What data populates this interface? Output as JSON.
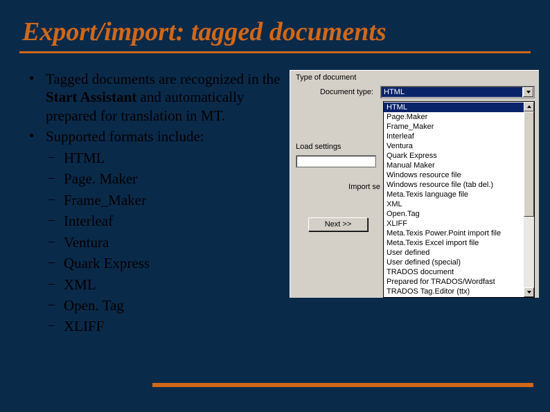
{
  "title": "Export/import: tagged documents",
  "bullets": {
    "b1_pre": "Tagged documents are recognized in the ",
    "b1_bold": "Start Assistant",
    "b1_post": " and automatically prepared for translation in MT.",
    "b2": "Supported formats include:",
    "formats": [
      "HTML",
      "Page. Maker",
      "Frame_Maker",
      "Interleaf",
      "Ventura",
      "Quark Express",
      "XML",
      "Open. Tag",
      "XLIFF"
    ]
  },
  "dialog": {
    "group": "Type of document",
    "doc_type_label": "Document type:",
    "selected": "HTML",
    "options": [
      "HTML",
      "Page.Maker",
      "Frame_Maker",
      "Interleaf",
      "Ventura",
      "Quark Express",
      "Manual Maker",
      "Windows resource file",
      "Windows resource file (tab del.)",
      "Meta.Texis language file",
      "XML",
      "Open.Tag",
      "XLIFF",
      "Meta.Texis Power.Point import file",
      "Meta.Texis Excel import file",
      "User defined",
      "User defined (special)",
      "TRADOS document",
      "Prepared for TRADOS/Wordfast",
      "TRADOS Tag.Editor (ttx)"
    ],
    "load_settings": "Load settings",
    "import_se": "Import se",
    "next": "Next  >>"
  }
}
